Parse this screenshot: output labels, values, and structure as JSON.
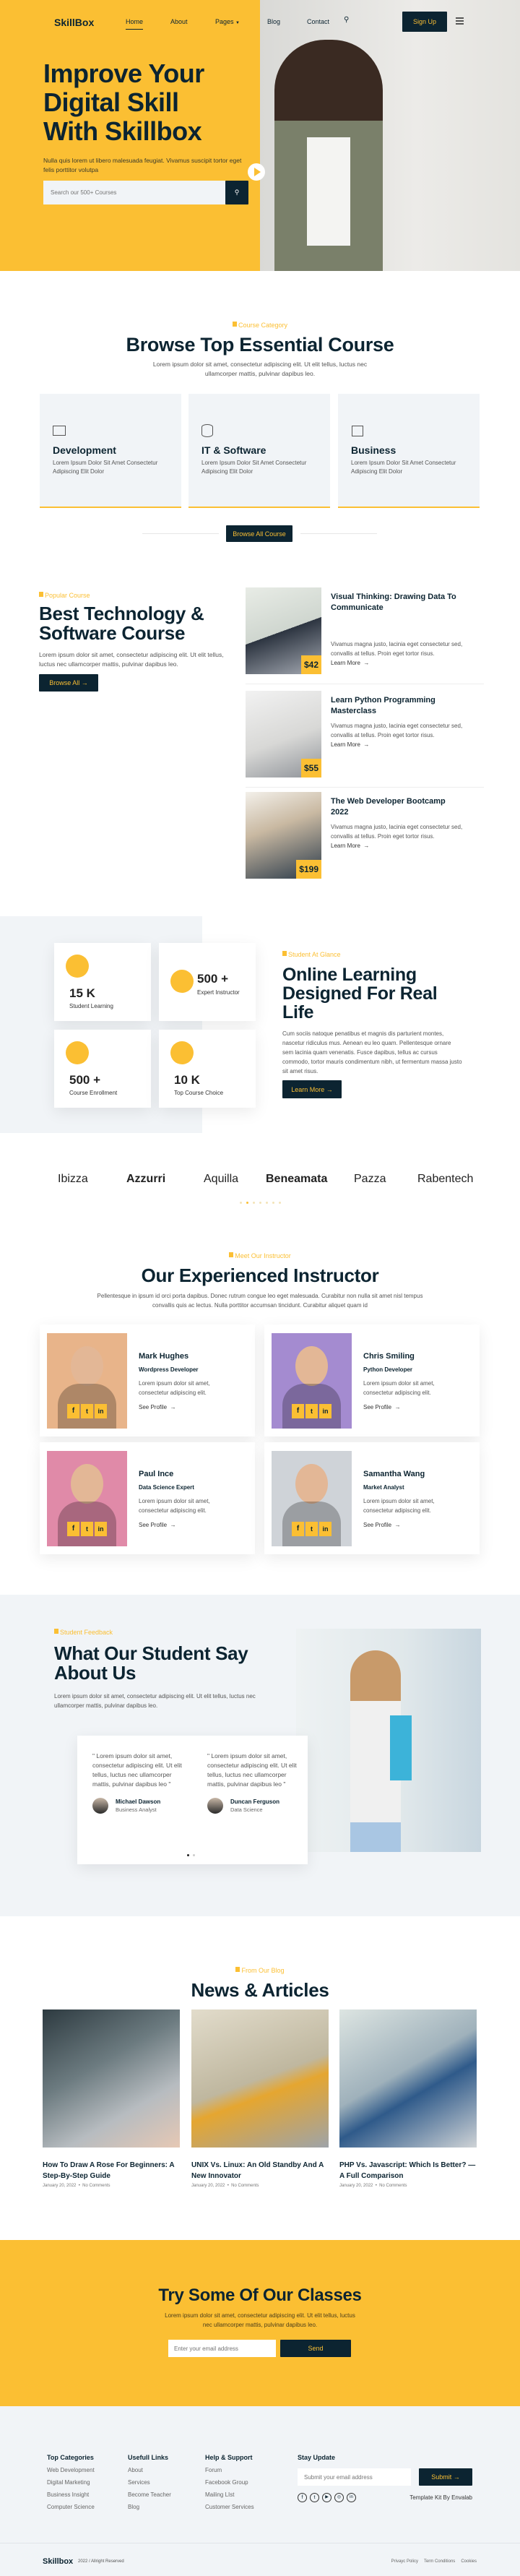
{
  "colors": {
    "accent": "#fbbf33",
    "dark": "#0c2431",
    "light_bg": "#f1f4f7"
  },
  "nav": {
    "logo": "SkillBox",
    "items": [
      "Home",
      "About",
      "Pages",
      "Blog",
      "Contact"
    ],
    "active": "Home",
    "signup": "Sign Up"
  },
  "hero": {
    "title_lines": [
      "Improve Your",
      "Digital Skill",
      "With Skillbox"
    ],
    "text": "Nulla quis lorem ut libero malesuada feugiat. Vivamus suscipit tortor eget felis porttitor volutpa",
    "search_placeholder": "Search our 500+ Courses"
  },
  "categories": {
    "label": "Course Category",
    "title": "Browse Top Essential Course",
    "text": "Lorem ipsum dolor sit amet, consectetur adipiscing elit. Ut elit tellus, luctus nec ullamcorper mattis, pulvinar dapibus leo.",
    "items": [
      {
        "title": "Development",
        "icon": "monitor-icon",
        "text": "Lorem Ipsum Dolor Sit Amet Consectetur Adipiscing Elit Dolor"
      },
      {
        "title": "IT & Software",
        "icon": "database-icon",
        "text": "Lorem Ipsum Dolor Sit Amet Consectetur Adipiscing Elit Dolor"
      },
      {
        "title": "Business",
        "icon": "briefcase-icon",
        "text": "Lorem Ipsum Dolor Sit Amet Consectetur Adipiscing Elit Dolor"
      }
    ],
    "button": "Browse All Course"
  },
  "popular": {
    "label": "Popular Course",
    "title_lines": [
      "Best Technology &",
      "Software Course"
    ],
    "text": "Lorem ipsum dolor sit amet, consectetur adipiscing elit. Ut elit tellus, luctus nec ullamcorper mattis, pulvinar dapibus leo.",
    "button": "Browse All",
    "courses": [
      {
        "title": "Visual Thinking: Drawing Data To Communicate",
        "text": "Vivamus magna justo, lacinia eget consectetur sed, convallis at tellus. Proin eget tortor risus.",
        "price": "$42",
        "link": "Learn More"
      },
      {
        "title": "Learn Python Programming Masterclass",
        "text": "Vivamus magna justo, lacinia eget consectetur sed, convallis at tellus. Proin eget tortor risus.",
        "price": "$55",
        "link": "Learn More"
      },
      {
        "title": "The Web Developer Bootcamp 2022",
        "text": "Vivamus magna justo, lacinia eget consectetur sed, convallis at tellus. Proin eget tortor risus.",
        "price": "$199",
        "link": "Learn More"
      }
    ]
  },
  "stats": {
    "items": [
      {
        "value": "15 K",
        "label": "Student Learning",
        "icon": "graduation-cap-icon"
      },
      {
        "value": "500 +",
        "label": "Expert Instructor",
        "icon": "group-icon"
      },
      {
        "value": "500 +",
        "label": "Course Enrollment",
        "icon": "bookmark-icon"
      },
      {
        "value": "10 K",
        "label": "Top Course Choice",
        "icon": "monitor-icon"
      }
    ],
    "label": "Student At Glance",
    "title_lines": [
      "Online Learning",
      "Designed For Real",
      "Life"
    ],
    "text": "Cum sociis natoque penatibus et magnis dis parturient montes, nascetur ridiculus mus. Aenean eu leo quam. Pellentesque ornare sem lacinia quam venenatis. Fusce dapibus, tellus ac cursus commodo, tortor mauris condimentum nibh, ut fermentum massa justo sit amet risus.",
    "button": "Learn More"
  },
  "brands": [
    "Ibizza",
    "Azzurri",
    "Aquilla",
    "Beneamata",
    "Pazza",
    "Rabentech"
  ],
  "instructors": {
    "label": "Meet Our Instructor",
    "title": "Our Experienced Instructor",
    "text": "Pellentesque in ipsum id orci porta dapibus. Donec rutrum congue leo eget malesuada. Curabitur non nulla sit amet nisl tempus convallis quis ac lectus. Nulla porttitor accumsan tincidunt. Curabitur aliquet quam id",
    "items": [
      {
        "name": "Mark Hughes",
        "role": "Wordpress Developer",
        "text": "Lorem ipsum dolor sit amet, consectetur adipiscing elit.",
        "link": "See Profile",
        "bg": "#e8b48a"
      },
      {
        "name": "Chris Smiling",
        "role": "Python Developer",
        "text": "Lorem ipsum dolor sit amet, consectetur adipiscing elit.",
        "link": "See Profile",
        "bg": "#a48bd0"
      },
      {
        "name": "Paul Ince",
        "role": "Data Science Expert",
        "text": "Lorem ipsum dolor sit amet, consectetur adipiscing elit.",
        "link": "See Profile",
        "bg": "#e08aa8"
      },
      {
        "name": "Samantha Wang",
        "role": "Market Analyst",
        "text": "Lorem ipsum dolor sit amet, consectetur adipiscing elit.",
        "link": "See Profile",
        "bg": "#cfd3d8"
      }
    ]
  },
  "feedback": {
    "label": "Student Feedback",
    "title_lines": [
      "What Our Student Say",
      "About Us"
    ],
    "text": "Lorem ipsum dolor sit amet, consectetur adipiscing elit. Ut elit tellus, luctus nec ullamcorper mattis, pulvinar dapibus leo.",
    "items": [
      {
        "quote": "\" Lorem ipsum dolor sit amet, consectetur adipiscing elit. Ut elit tellus, luctus nec ullamcorper mattis, pulvinar dapibus leo \"",
        "name": "Michael Dawson",
        "role": "Business Analyst"
      },
      {
        "quote": "\" Lorem ipsum dolor sit amet, consectetur adipiscing elit. Ut elit tellus, luctus nec ullamcorper mattis, pulvinar dapibus leo \"",
        "name": "Duncan Ferguson",
        "role": "Data Science"
      }
    ]
  },
  "news": {
    "label": "From Our Blog",
    "title": "News & Articles",
    "items": [
      {
        "title": "How To Draw A Rose For Beginners: A Step-By-Step Guide",
        "date": "January 20, 2022",
        "comments": "No Comments"
      },
      {
        "title": "UNIX Vs. Linux: An Old Standby And A New Innovator",
        "date": "January 20, 2022",
        "comments": "No Comments"
      },
      {
        "title": "PHP Vs. Javascript: Which Is Better? — A Full Comparison",
        "date": "January 20, 2022",
        "comments": "No Comments"
      }
    ]
  },
  "cta": {
    "title": "Try Some Of Our Classes",
    "text": "Lorem ipsum dolor sit amet, consectetur adipiscing elit. Ut elit tellus, luctus nec ullamcorper mattis, pulvinar dapibus leo.",
    "placeholder": "Enter your email address",
    "button": "Send"
  },
  "footer": {
    "columns": [
      {
        "title": "Top Categories",
        "links": [
          "Web Development",
          "Digital Marketing",
          "Business Insight",
          "Computer Science"
        ]
      },
      {
        "title": "Usefull Links",
        "links": [
          "About",
          "Services",
          "Become Teacher",
          "Blog"
        ]
      },
      {
        "title": "Help & Support",
        "links": [
          "Forum",
          "Facebook Group",
          "Mailing LIst",
          "Customer Services"
        ]
      }
    ],
    "stay_title": "Stay Update",
    "placeholder": "Submit your email address",
    "submit": "Submit",
    "credit": "Template Kit By Envalab",
    "logo": "Skillbox",
    "copyright": "2022 / Allright Reserved",
    "legal": [
      "Privayc Policy",
      "Term Conditions",
      "Cookies"
    ],
    "social": [
      "facebook-icon",
      "twitter-icon",
      "youtube-icon",
      "instagram-icon",
      "linkedin-icon"
    ]
  }
}
